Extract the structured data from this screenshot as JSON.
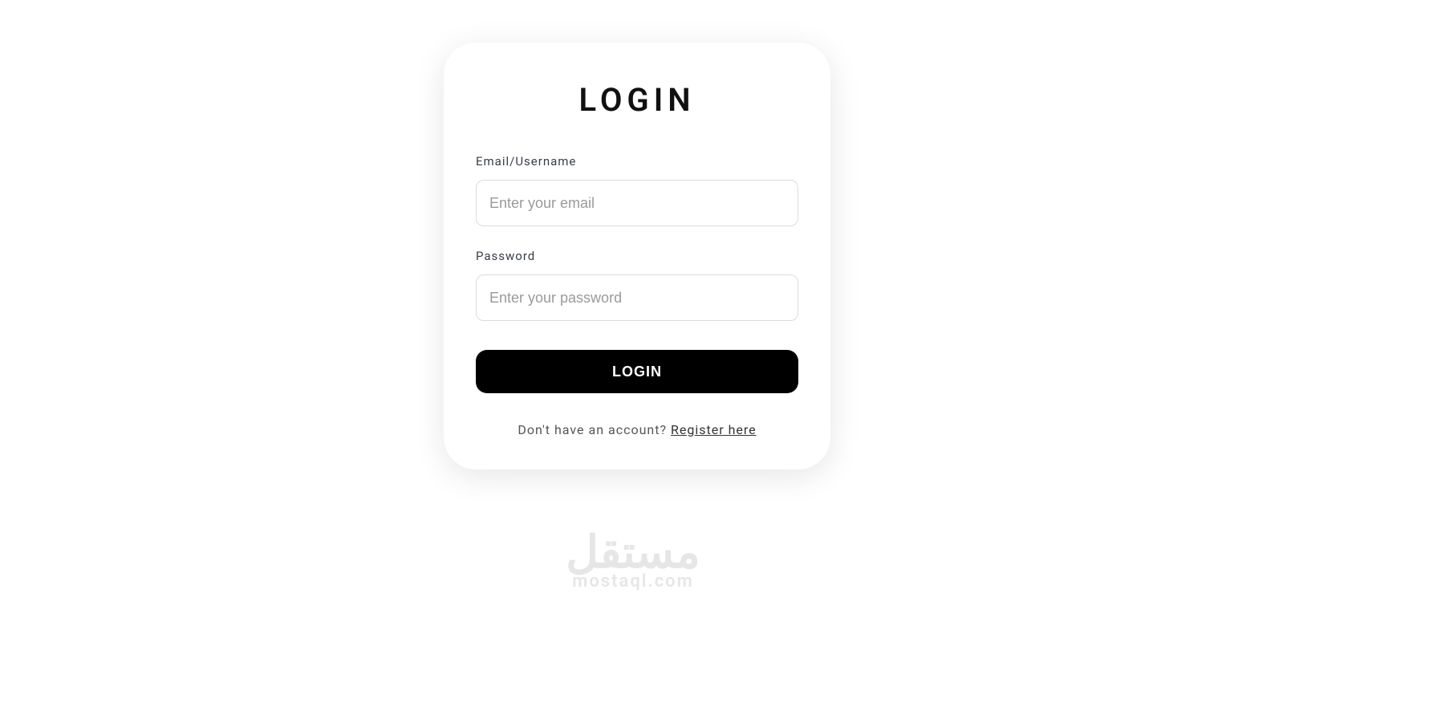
{
  "card": {
    "title": "LOGIN",
    "emailLabel": "Email/Username",
    "emailPlaceholder": "Enter your email",
    "passwordLabel": "Password",
    "passwordPlaceholder": "Enter your password",
    "loginButton": "LOGIN",
    "noAccountText": "Don't have an account? ",
    "registerLink": "Register here"
  },
  "watermark": {
    "arabic": "مستقل",
    "latin": "mostaql.com"
  }
}
